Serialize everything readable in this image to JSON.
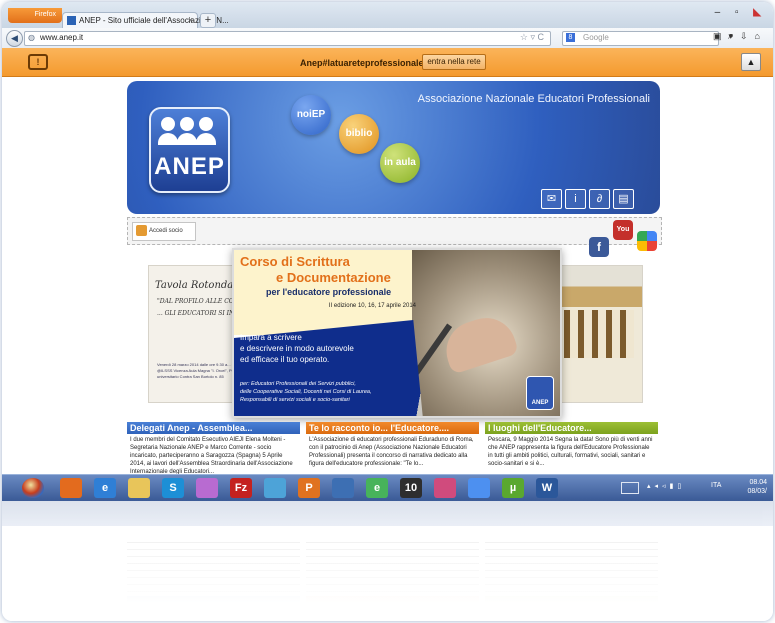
{
  "browser": {
    "menu_button": "Firefox",
    "tab_title": "ANEP - Sito ufficiale dell'Associazione N...",
    "new_tab": "+",
    "url": "www.anep.it",
    "search_placeholder": "Google"
  },
  "notification": {
    "text": "Anep#latuareteprofessionale",
    "button": "entra nella rete"
  },
  "banner": {
    "title": "Associazione Nazionale Educatori Professionali",
    "logo_text": "ANEP",
    "orbs": [
      "noiEP",
      "biblio",
      "in aula"
    ]
  },
  "access": {
    "login_label": "Accedi socio"
  },
  "social": {
    "youtube": "You Tube"
  },
  "slide_left": {
    "heading": "Tavola Rotonda",
    "line1": "\"DAL PROFILO ALLE COM",
    "line2": "... GLI EDUCATORI SI IN",
    "info": "Venerdì 28 marzo 2014 dalle ore 9.30 a... c/o @ILSSS Vicenza Aula Magna \"I. Orcel\", Polo universitario Contra San Bortolo n. 85"
  },
  "main_slide": {
    "title1": "Corso di Scrittura",
    "title2": "e Documentazione",
    "subtitle": "per l'educatore professionale",
    "edition": "II edizione 10, 16, 17 aprile 2014",
    "body_line1": "Impara a scrivere",
    "body_line2": "e descrivere in modo autorevole",
    "body_line3": "ed efficace il tuo operato.",
    "for_line1": "per: Educatori Professionali dei Servizi pubblici,",
    "for_line2": "delle Cooperative Sociali, Docenti nei Corsi di Laurea,",
    "for_line3": "Responsabili di servizi sociali e socio-sanitari",
    "logo_text": "ANEP"
  },
  "news": [
    {
      "title": "Delegati Anep - Assemblea...",
      "body": "I due membri del Comitato Esecutivo AIEJI Elena Molteni - Segretaria Nazionale ANEP e Marco Corrente - socio incaricato, parteciperanno a Saragozza (Spagna) 5 Aprile 2014, ai lavori dell'Assemblea Straordinaria dell'Associazione Internazionale degli Educatori..."
    },
    {
      "title": "Te lo racconto io... l'Educatore....",
      "body": "L'Associazione di educatori professionali Eduraduno di Roma, con il patrocinio di Anep (Associazione Nazionale Educatori Professionali) presenta il concorso di narrativa dedicato alla figura dell'educatore professionale: \"Te lo..."
    },
    {
      "title": "I luoghi dell'Educatore...",
      "body": "Pescara, 9 Maggio 2014 Segna la data! Sono più di venti anni che ANEP rappresenta la figura dell'Educatore Professionale in tutti gli ambiti politici, culturali, formativi, sociali, sanitari e socio-sanitari e si è..."
    }
  ],
  "taskbar": {
    "icons": [
      "firefox-icon",
      "ie-icon",
      "explorer-icon",
      "skype-icon",
      "feather-icon",
      "filezilla-icon",
      "notepad-icon",
      "powerpoint-icon",
      "thunderbird-icon",
      "browser-icon",
      "ten-icon",
      "pink-icon",
      "chrome-icon",
      "utorrent-icon",
      "word-icon"
    ],
    "labels": [
      "",
      "e",
      "",
      "S",
      "",
      "Fz",
      "",
      "P",
      "",
      "e",
      "10",
      "",
      "",
      "µ",
      "W"
    ],
    "colors": [
      "#e36b1e",
      "#2f7fd6",
      "#e8c55a",
      "#1d8fd6",
      "#b86bd1",
      "#c4221f",
      "#4da3d8",
      "#e07220",
      "#3d6fb3",
      "#47b35b",
      "#2e2e2e",
      "#d04b7d",
      "#4d90f0",
      "#5aa82f",
      "#2b579a"
    ],
    "language": "ITA",
    "time": "08.04",
    "date": "08/03/"
  }
}
